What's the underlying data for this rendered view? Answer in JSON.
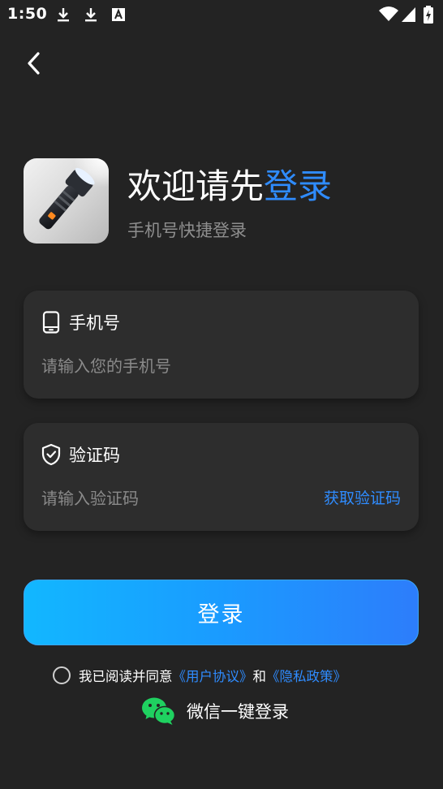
{
  "status_bar": {
    "time": "1:50",
    "notification_icons": [
      "download-icon",
      "download-icon",
      "a-box-icon"
    ],
    "right_icons": [
      "wifi-icon",
      "cell-signal-icon",
      "battery-charging-icon"
    ]
  },
  "nav": {
    "back_icon": "chevron-left-icon"
  },
  "header": {
    "title_prefix": "欢迎请先",
    "title_highlight": "登录",
    "subtitle": "手机号快捷登录"
  },
  "phone_card": {
    "icon": "phone-icon",
    "label": "手机号",
    "placeholder": "请输入您的手机号",
    "value": ""
  },
  "code_card": {
    "icon": "shield-check-icon",
    "label": "验证码",
    "placeholder": "请输入验证码",
    "value": "",
    "get_code_label": "获取验证码"
  },
  "login_button": {
    "label": "登录"
  },
  "agreement": {
    "checked": false,
    "text_prefix": "我已阅读并同意",
    "user_agreement": "《用户协议》",
    "connector": "和",
    "privacy_policy": "《隐私政策》"
  },
  "wechat": {
    "icon": "wechat-icon",
    "label": "微信一键登录"
  },
  "colors": {
    "background": "#232323",
    "card": "#2d2d2d",
    "accent": "#2f8cff",
    "button_gradient_start": "#12b7ff",
    "button_gradient_end": "#2d7dfb",
    "wechat_green": "#1fd160"
  }
}
